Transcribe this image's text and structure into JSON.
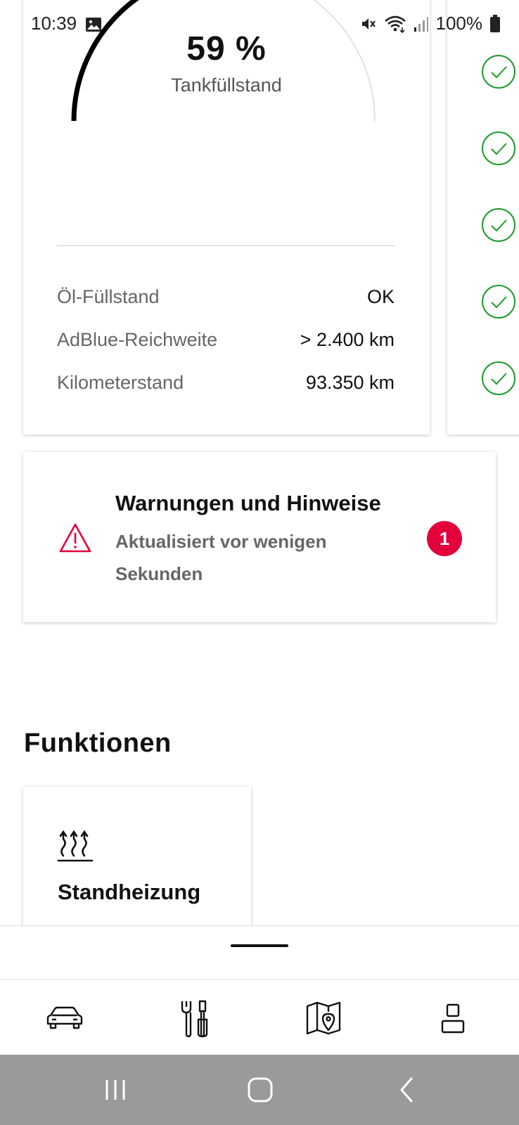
{
  "status_bar": {
    "time": "10:39",
    "battery": "100%",
    "icons": [
      "image-icon",
      "mute-icon",
      "wifi-icon",
      "signal-icon",
      "battery-icon"
    ]
  },
  "fuel_card": {
    "value": "59 %",
    "label": "Tankfüllstand",
    "level_fraction": 0.59,
    "stats": [
      {
        "label": "Öl-Füllstand",
        "value": "OK"
      },
      {
        "label": "AdBlue-Reichweite",
        "value": "> 2.400 km"
      },
      {
        "label": "Kilometerstand",
        "value": "93.350 km"
      }
    ]
  },
  "side_card": {
    "checks": [
      "check-icon",
      "check-icon",
      "check-icon",
      "check-icon",
      "check-icon"
    ],
    "check_color": "#1f9a2c"
  },
  "warnings": {
    "title": "Warnungen und Hinweise",
    "subtitle": "Aktualisiert vor wenigen Sekunden",
    "badge": "1",
    "accent_color": "#e4003a"
  },
  "functions": {
    "title": "Funktionen",
    "items": [
      {
        "label": "Standheizung",
        "icon": "heat-icon"
      }
    ]
  },
  "nav": {
    "items": [
      "car-icon",
      "tools-icon",
      "map-icon",
      "profile-icon"
    ]
  },
  "system_nav": {
    "items": [
      "recent-apps-icon",
      "home-icon",
      "back-icon"
    ]
  }
}
